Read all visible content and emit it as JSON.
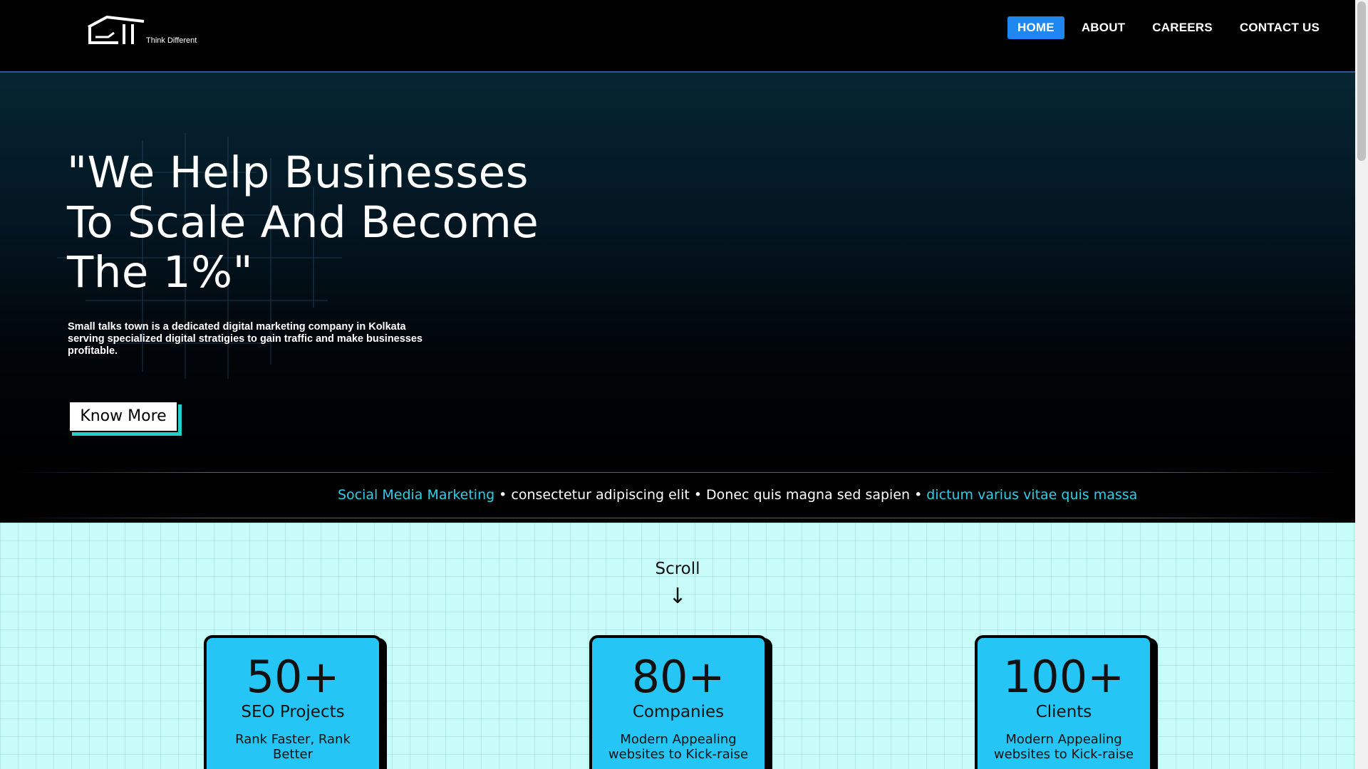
{
  "header": {
    "logo_tagline": "Think Different",
    "nav": [
      {
        "label": "HOME",
        "active": true
      },
      {
        "label": "ABOUT",
        "active": false
      },
      {
        "label": "CAREERS",
        "active": false
      },
      {
        "label": "CONTACT US",
        "active": false
      }
    ]
  },
  "hero": {
    "title_line1": "\"We Help Businesses",
    "title_line2": "To Scale And Become",
    "title_line3": "The 1%\"",
    "description": "Small talks town is a dedicated digital marketing company in Kolkata serving specialized digital stratigies to gain traffic and make businesses profitable.",
    "cta_label": "Know More"
  },
  "marquee": {
    "items": [
      "Social Media Marketing",
      "consectetur adipiscing elit",
      "Donec quis magna sed sapien",
      "dictum varius vitae quis massa"
    ],
    "separator": "•"
  },
  "stats": {
    "scroll_label": "Scroll",
    "scroll_arrow": "↓",
    "cards": [
      {
        "number": "50+",
        "title": "SEO Projects",
        "desc": "Rank Faster, Rank Better"
      },
      {
        "number": "80+",
        "title": "Companies",
        "desc": "Modern Appealing websites to Kick-raise"
      },
      {
        "number": "100+",
        "title": "Clients",
        "desc": "Modern Appealing websites to Kick-raise"
      }
    ]
  },
  "colors": {
    "nav_active": "#1e88f0",
    "accent_cyan": "#2bd0e8",
    "card_bg": "#25c6f5",
    "section_bg": "#c7fcf8",
    "button_shadow": "#21d1c7"
  }
}
